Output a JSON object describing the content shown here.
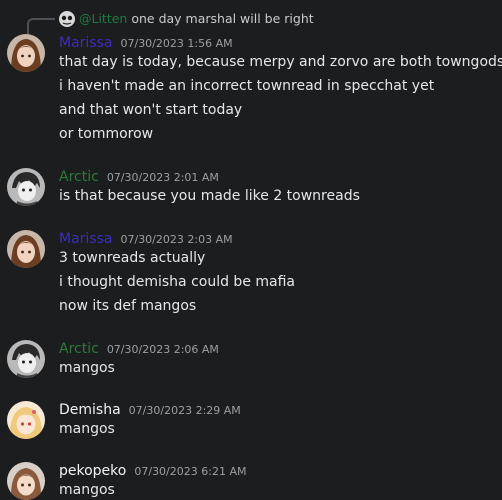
{
  "reply": {
    "author": "@Litten",
    "text": "one day marshal will be right"
  },
  "messages": [
    {
      "author": "Marissa",
      "author_color": "#3b2fb8",
      "timestamp": "07/30/2023 1:56 AM",
      "lines": [
        "that day is today, because merpy and zorvo are both towngods",
        "i haven't made an incorrect townread in specchat yet",
        "and that won't start today",
        "or tommorow"
      ]
    },
    {
      "author": "Arctic",
      "author_color": "#2d7a3a",
      "timestamp": "07/30/2023 2:01 AM",
      "lines": [
        "is that because you made like 2 townreads"
      ]
    },
    {
      "author": "Marissa",
      "author_color": "#3b2fb8",
      "timestamp": "07/30/2023 2:03 AM",
      "lines": [
        "3 townreads actually",
        "i thought demisha could be mafia",
        "now its def mangos"
      ]
    },
    {
      "author": "Arctic",
      "author_color": "#2d7a3a",
      "timestamp": "07/30/2023 2:06 AM",
      "lines": [
        "mangos"
      ]
    },
    {
      "author": "Demisha",
      "author_color": "#f2f3f5",
      "timestamp": "07/30/2023 2:29 AM",
      "lines": [
        "mangos"
      ]
    },
    {
      "author": "pekopeko",
      "author_color": "#f2f3f5",
      "timestamp": "07/30/2023 6:21 AM",
      "lines": [
        "mangos"
      ]
    }
  ]
}
